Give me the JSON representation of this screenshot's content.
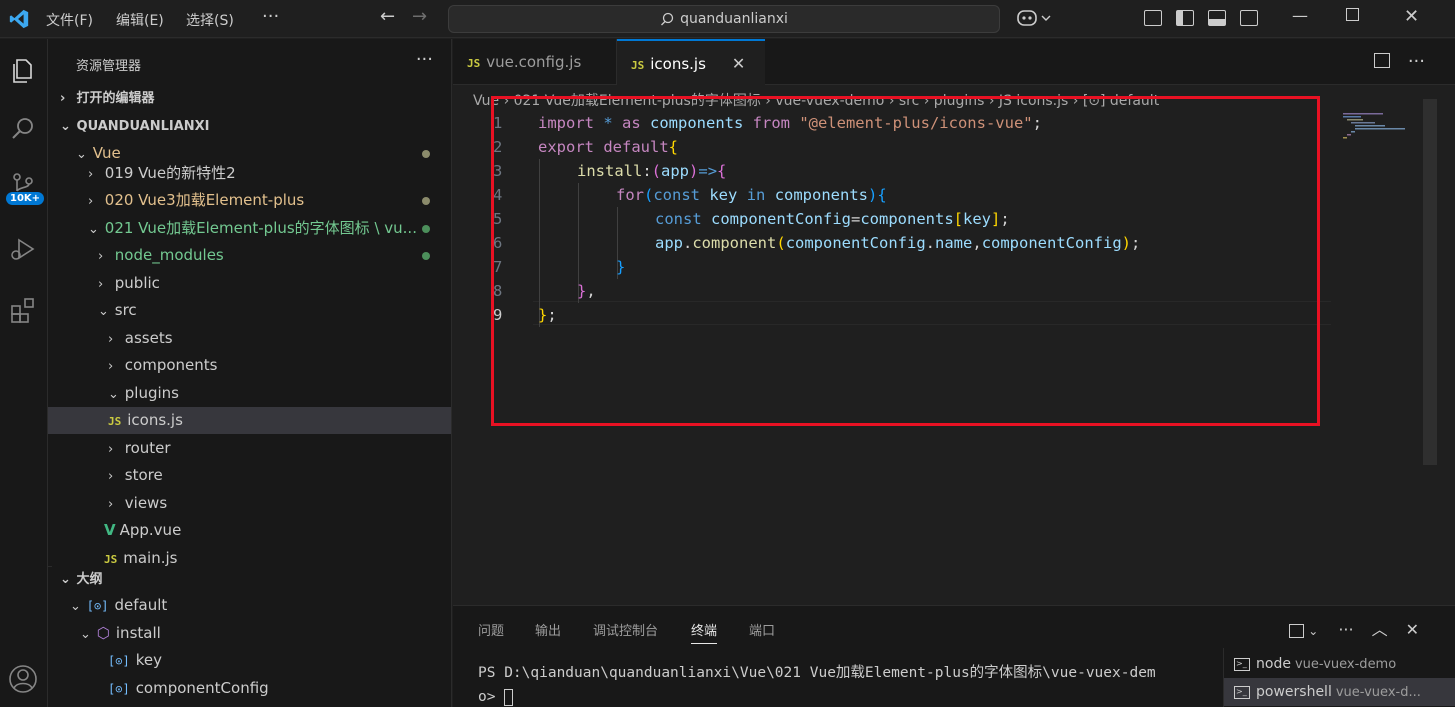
{
  "titlebar": {
    "menus": [
      "文件(F)",
      "编辑(E)",
      "选择(S)"
    ],
    "more": "···",
    "search": "quanduanlianxi"
  },
  "activity": {
    "badge": "10K+"
  },
  "sidebar": {
    "header": "资源管理器",
    "more": "···",
    "open_editors": "打开的编辑器",
    "workspace": "QUANDUANLIANXI",
    "tree": [
      {
        "label": "Vue",
        "chev": "⌄"
      },
      {
        "label": "019 Vue的新特性2",
        "chev": "›"
      },
      {
        "label": "020 Vue3加载Element-plus",
        "chev": "›"
      },
      {
        "label": "021 Vue加载Element-plus的字体图标 \\ vu...",
        "chev": "⌄"
      },
      {
        "label": "node_modules",
        "chev": "›"
      },
      {
        "label": "public",
        "chev": "›"
      },
      {
        "label": "src",
        "chev": "⌄"
      },
      {
        "label": "assets",
        "chev": "›"
      },
      {
        "label": "components",
        "chev": "›"
      },
      {
        "label": "plugins",
        "chev": "⌄"
      },
      {
        "label": "icons.js",
        "icon": "JS"
      },
      {
        "label": "router",
        "chev": "›"
      },
      {
        "label": "store",
        "chev": "›"
      },
      {
        "label": "views",
        "chev": "›"
      },
      {
        "label": "App.vue",
        "icon": "V"
      },
      {
        "label": "main.js",
        "icon": "JS"
      }
    ],
    "outline_title": "大纲",
    "outline": [
      {
        "label": "default",
        "icon": "[⊙]"
      },
      {
        "label": "install",
        "icon": "⬡"
      },
      {
        "label": "key",
        "icon": "[⊙]"
      },
      {
        "label": "componentConfig",
        "icon": "[⊙]"
      }
    ]
  },
  "editor": {
    "tabs": [
      {
        "label": "vue.config.js",
        "icon": "JS"
      },
      {
        "label": "icons.js",
        "icon": "JS",
        "close": "✕"
      }
    ],
    "breadcrumb": "Vue › 021 Vue加载Element-plus的字体图标 › vue-vuex-demo › src › plugins › JS icons.js › [⊙] default",
    "line_numbers": [
      "1",
      "2",
      "3",
      "4",
      "5",
      "6",
      "7",
      "8",
      "9"
    ],
    "code": {
      "l1": {
        "a": "import",
        "b": " * ",
        "c": "as",
        "d": " components ",
        "e": "from",
        "f": " \"@element-plus/icons-vue\"",
        "g": ";"
      },
      "l2": {
        "a": "export",
        "b": " ",
        "c": "default",
        "d": "{"
      },
      "l3": {
        "a": "install",
        "b": ":",
        "c": "(",
        "d": "app",
        "e": ")",
        "f": "=>",
        "g": "{"
      },
      "l4": {
        "a": "for",
        "b": "(",
        "c": "const",
        "d": " key ",
        "e": "in",
        "f": " components",
        "g": ")",
        "h": "{"
      },
      "l5": {
        "a": "const",
        "b": " componentConfig",
        "c": "=",
        "d": "components",
        "e": "[",
        "f": "key",
        "g": "]",
        "h": ";"
      },
      "l6": {
        "a": "app",
        "b": ".",
        "c": "component",
        "d": "(",
        "e": "componentConfig",
        "f": ".",
        "g": "name",
        "h": ",",
        "i": "componentConfig",
        "j": ")",
        "k": ";"
      },
      "l7": {
        "a": "}"
      },
      "l8": {
        "a": "}",
        "b": ","
      },
      "l9": {
        "a": "}",
        "b": ";"
      }
    }
  },
  "panel": {
    "tabs": [
      "问题",
      "输出",
      "调试控制台",
      "终端",
      "端口"
    ],
    "terminal_line1": "PS D:\\qianduan\\quanduanlianxi\\Vue\\021 Vue加载Element-plus的字体图标\\vue-vuex-dem",
    "terminal_line2": "o> ",
    "terminals": [
      {
        "name": "node",
        "sub": "vue-vuex-demo"
      },
      {
        "name": "powershell",
        "sub": "vue-vuex-d..."
      }
    ]
  },
  "colors": {
    "accent": "#0078d4",
    "highlight_box": "#e81123"
  }
}
